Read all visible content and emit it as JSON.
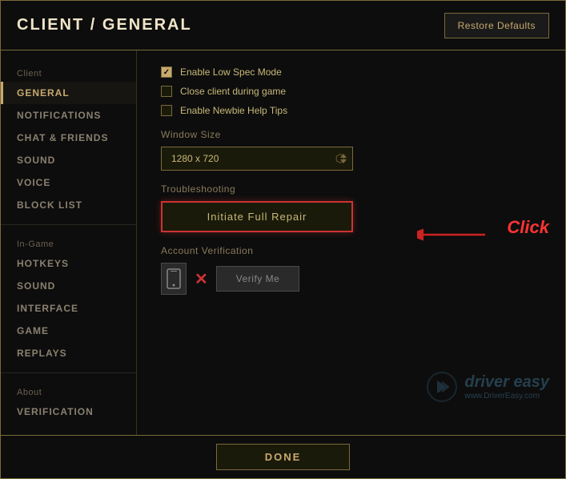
{
  "header": {
    "title_prefix": "CLIENT / ",
    "title_bold": "GENERAL",
    "restore_button": "Restore Defaults"
  },
  "sidebar": {
    "section1_label": "Client",
    "items_client": [
      {
        "label": "GENERAL",
        "active": true
      },
      {
        "label": "NOTIFICATIONS",
        "active": false
      },
      {
        "label": "CHAT & FRIENDS",
        "active": false
      },
      {
        "label": "SOUND",
        "active": false
      },
      {
        "label": "VOICE",
        "active": false
      },
      {
        "label": "BLOCK LIST",
        "active": false
      }
    ],
    "section2_label": "In-Game",
    "items_ingame": [
      {
        "label": "HOTKEYS",
        "active": false
      },
      {
        "label": "SOUND",
        "active": false
      },
      {
        "label": "INTERFACE",
        "active": false
      },
      {
        "label": "GAME",
        "active": false
      },
      {
        "label": "REPLAYS",
        "active": false
      }
    ],
    "section3_label": "About",
    "items_about": [
      {
        "label": "VERIFICATION",
        "active": false
      }
    ]
  },
  "content": {
    "checkboxes": [
      {
        "label": "Enable Low Spec Mode",
        "checked": true
      },
      {
        "label": "Close client during game",
        "checked": false
      },
      {
        "label": "Enable Newbie Help Tips",
        "checked": false
      }
    ],
    "window_size_label": "Window Size",
    "window_size_value": "1280 x 720",
    "troubleshooting_label": "Troubleshooting",
    "initiate_repair_button": "Initiate Full Repair",
    "account_verification_label": "Account Verification",
    "verify_me_button": "Verify Me"
  },
  "annotation": {
    "click_text": "Click"
  },
  "watermark": {
    "name": "driver easy",
    "url": "www.DriverEasy.com"
  },
  "footer": {
    "done_button": "DONE"
  }
}
